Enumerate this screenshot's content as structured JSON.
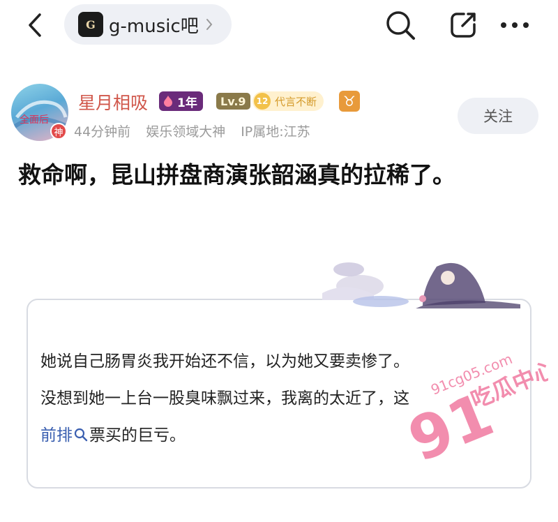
{
  "header": {
    "forum_name": "g-music吧",
    "forum_logo_text": "G",
    "icons": [
      "back-icon",
      "search-icon",
      "share-icon",
      "more-icon"
    ]
  },
  "author": {
    "name": "星月相吸",
    "year_badge": "1年",
    "level_badge": "Lv.9",
    "daiyan_level": "12",
    "daiyan_badge": "代言不断",
    "zodiac": "♉",
    "avatar_badge": "神",
    "time": "44分钟前",
    "title": "娱乐领域大神",
    "ip": "IP属地:江苏",
    "follow_label": "关注"
  },
  "post": {
    "title": "救命啊，昆山拼盘商演张韶涵真的拉稀了。"
  },
  "quote": {
    "line1": "她说自己肠胃炎我开始还不信，以为她又要卖惨了。",
    "line2": "没想到她一上台一股臭味飘过来，我离的太近了，这",
    "line3_link": "前排",
    "line3_rest": "票买的巨亏。"
  },
  "watermark": {
    "number": "91",
    "site": "91cg05.com",
    "label": "吃瓜中心"
  },
  "colors": {
    "author_name": "#d0564a",
    "link": "#3a5fb0",
    "pill_bg": "#eef0f5",
    "watermark": "#f07aa0"
  }
}
